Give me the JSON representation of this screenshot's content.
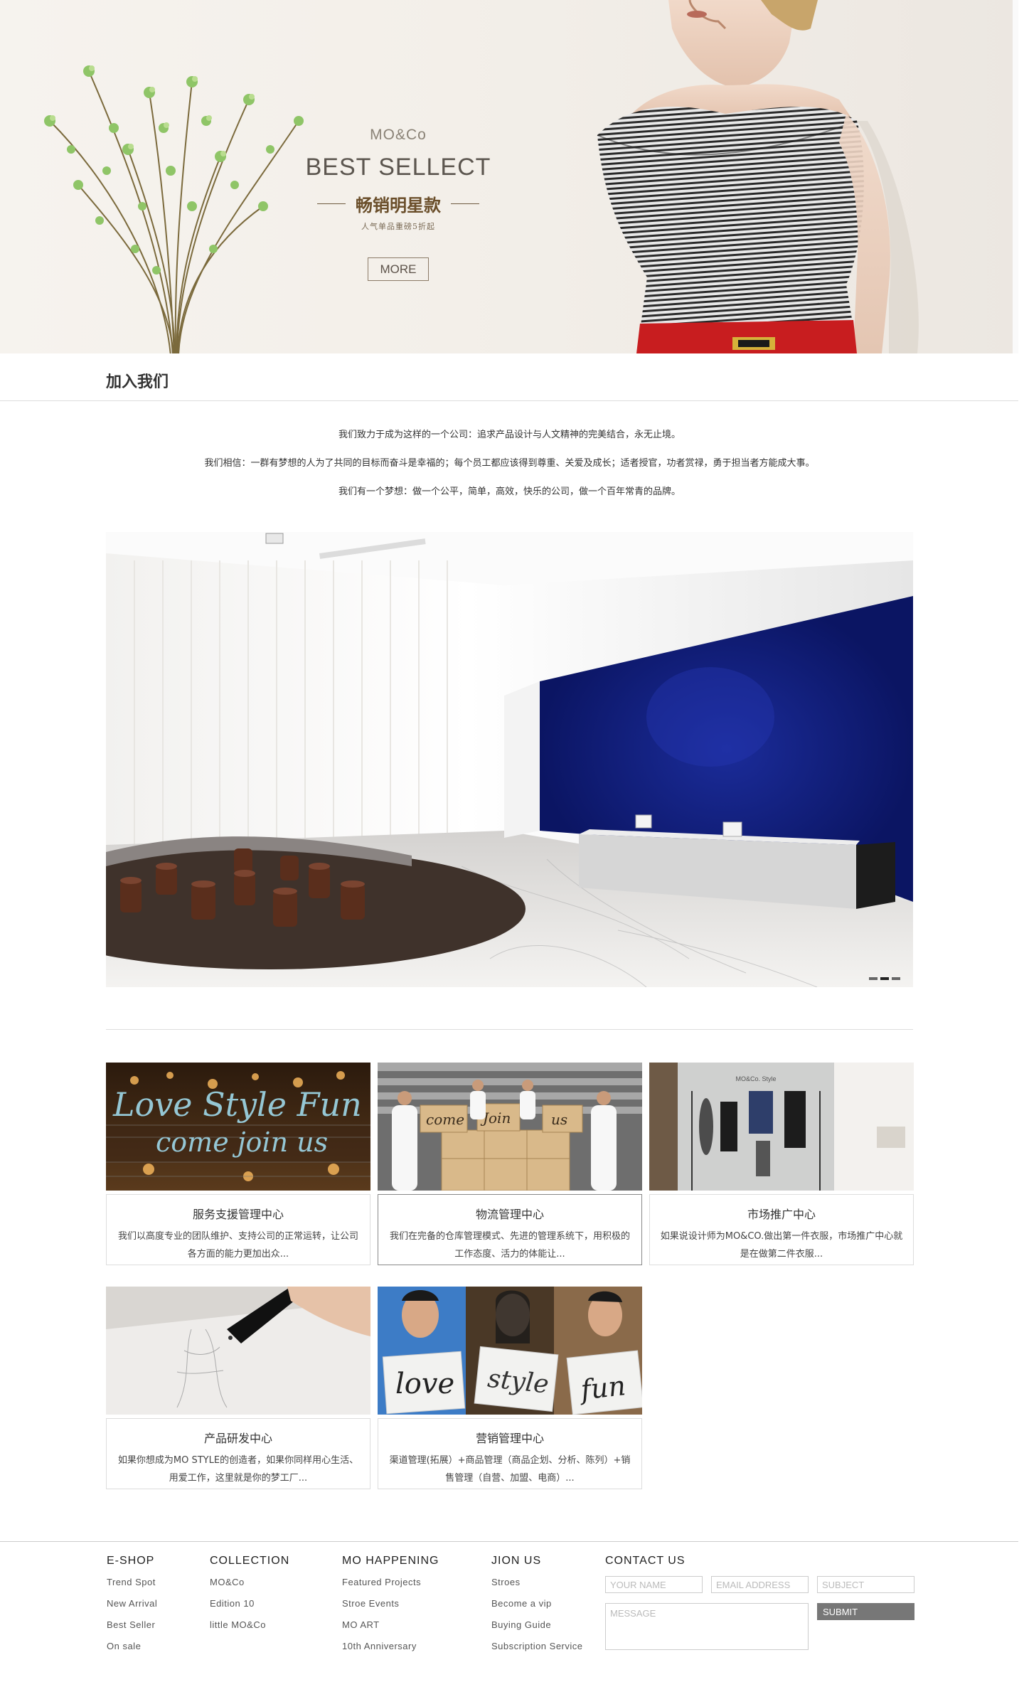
{
  "hero": {
    "brand": "MO&Co",
    "title": "BEST SELLECT",
    "subtitle": "畅销明星款",
    "note": "人气单品重磅5折起",
    "more_label": "MORE"
  },
  "join": {
    "title": "加入我们",
    "intro": [
      "我们致力于成为这样的一个公司：追求产品设计与人文精神的完美结合，永无止境。",
      "我们相信：一群有梦想的人为了共同的目标而奋斗是幸福的；每个员工都应该得到尊重、关爱及成长；适者授官，功者赏禄，勇于担当者方能成大事。",
      "我们有一个梦想：做一个公平，简单，高效，快乐的公司，做一个百年常青的品牌。"
    ]
  },
  "photos": {
    "join_text": [
      "come",
      "Join",
      "us"
    ],
    "love_text": [
      "love",
      "style",
      "fun"
    ],
    "neon_lines": [
      "Love Style Fun",
      "come join us"
    ],
    "showroom_sign": "MO&Co. Style"
  },
  "cards": [
    {
      "title": "服务支援管理中心",
      "desc": "我们以高度专业的团队维护、支持公司的正常运转，让公司各方面的能力更加出众..."
    },
    {
      "title": "物流管理中心",
      "desc": "我们在完备的仓库管理模式、先进的管理系统下，用积极的工作态度、活力的体能让..."
    },
    {
      "title": "市场推广中心",
      "desc": "如果说设计师为MO&CO.做出第一件衣服，市场推广中心就是在做第二件衣服..."
    },
    {
      "title": "产品研发中心",
      "desc": "如果你想成为MO STYLE的创造者，如果你同样用心生活、用爱工作，这里就是你的梦工厂..."
    },
    {
      "title": "营销管理中心",
      "desc": "渠道管理(拓展）+商品管理（商品企划、分析、陈列）+销售管理（自营、加盟、电商）..."
    }
  ],
  "footer": {
    "columns": [
      {
        "title": "E-SHOP",
        "links": [
          "Trend Spot",
          "New Arrival",
          "Best Seller",
          "On sale"
        ]
      },
      {
        "title": "COLLECTION",
        "links": [
          "MO&Co",
          "Edition 10",
          "little MO&Co"
        ]
      },
      {
        "title": "MO HAPPENING",
        "links": [
          "Featured Projects",
          "Stroe Events",
          "MO ART",
          "10th Anniversary"
        ]
      },
      {
        "title": "JION US",
        "links": [
          "Stroes",
          "Become a vip",
          "Buying Guide",
          "Subscription Service"
        ]
      }
    ],
    "contact": {
      "title": "CONTACT US",
      "name_placeholder": "YOUR NAME",
      "email_placeholder": "EMAIL ADDRESS",
      "subject_placeholder": "SUBJECT",
      "message_placeholder": "MESSAGE",
      "submit_label": "SUBMIT"
    }
  },
  "colors": {
    "accent_brown": "#6a4e2a",
    "lobby_blue": "#0e1a72",
    "submit_gray": "#777777",
    "neon": "#9fd9ea"
  }
}
